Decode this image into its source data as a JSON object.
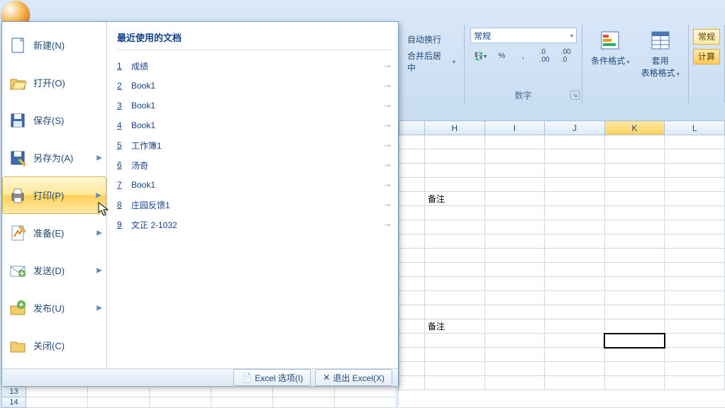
{
  "menu": {
    "items": [
      {
        "label": "新建(N)",
        "shortcut": "N",
        "icon": "new",
        "arrow": false
      },
      {
        "label": "打开(O)",
        "shortcut": "O",
        "icon": "open",
        "arrow": false
      },
      {
        "label": "保存(S)",
        "shortcut": "S",
        "icon": "save",
        "arrow": false
      },
      {
        "label": "另存为(A)",
        "shortcut": "A",
        "icon": "saveas",
        "arrow": true
      },
      {
        "label": "打印(P)",
        "shortcut": "P",
        "icon": "print",
        "arrow": true,
        "hover": true
      },
      {
        "label": "准备(E)",
        "shortcut": "E",
        "icon": "prepare",
        "arrow": true
      },
      {
        "label": "发送(D)",
        "shortcut": "D",
        "icon": "send",
        "arrow": true
      },
      {
        "label": "发布(U)",
        "shortcut": "U",
        "icon": "publish",
        "arrow": true
      },
      {
        "label": "关闭(C)",
        "shortcut": "C",
        "icon": "close",
        "arrow": false
      }
    ],
    "recent_title": "最近使用的文档",
    "recent": [
      {
        "n": "1",
        "name": "成绩"
      },
      {
        "n": "2",
        "name": "Book1"
      },
      {
        "n": "3",
        "name": "Book1"
      },
      {
        "n": "4",
        "name": "Book1"
      },
      {
        "n": "5",
        "name": "工作簿1"
      },
      {
        "n": "6",
        "name": "汤奇"
      },
      {
        "n": "7",
        "name": "Book1"
      },
      {
        "n": "8",
        "name": "庄园反馈1"
      },
      {
        "n": "9",
        "name": "文正 2-1032"
      }
    ],
    "footer": {
      "options": "Excel 选项(I)",
      "exit": "退出 Excel(X)"
    }
  },
  "ribbon": {
    "align": {
      "wrap": "自动换行",
      "merge": "合并后居中"
    },
    "number": {
      "group": "数字",
      "format": "常规",
      "currency": "",
      "percent": "%",
      "comma": ",",
      "inc": ".0",
      "dec": ".00"
    },
    "styles": {
      "cond": "条件格式",
      "table": "套用\n表格格式"
    },
    "extra": {
      "b1": "常规",
      "b2": "计算"
    }
  },
  "grid": {
    "cols": [
      "H",
      "I",
      "J",
      "K",
      "L"
    ],
    "selcol": "K",
    "notes": "备注",
    "rowhdr": [
      "13",
      "14"
    ]
  }
}
